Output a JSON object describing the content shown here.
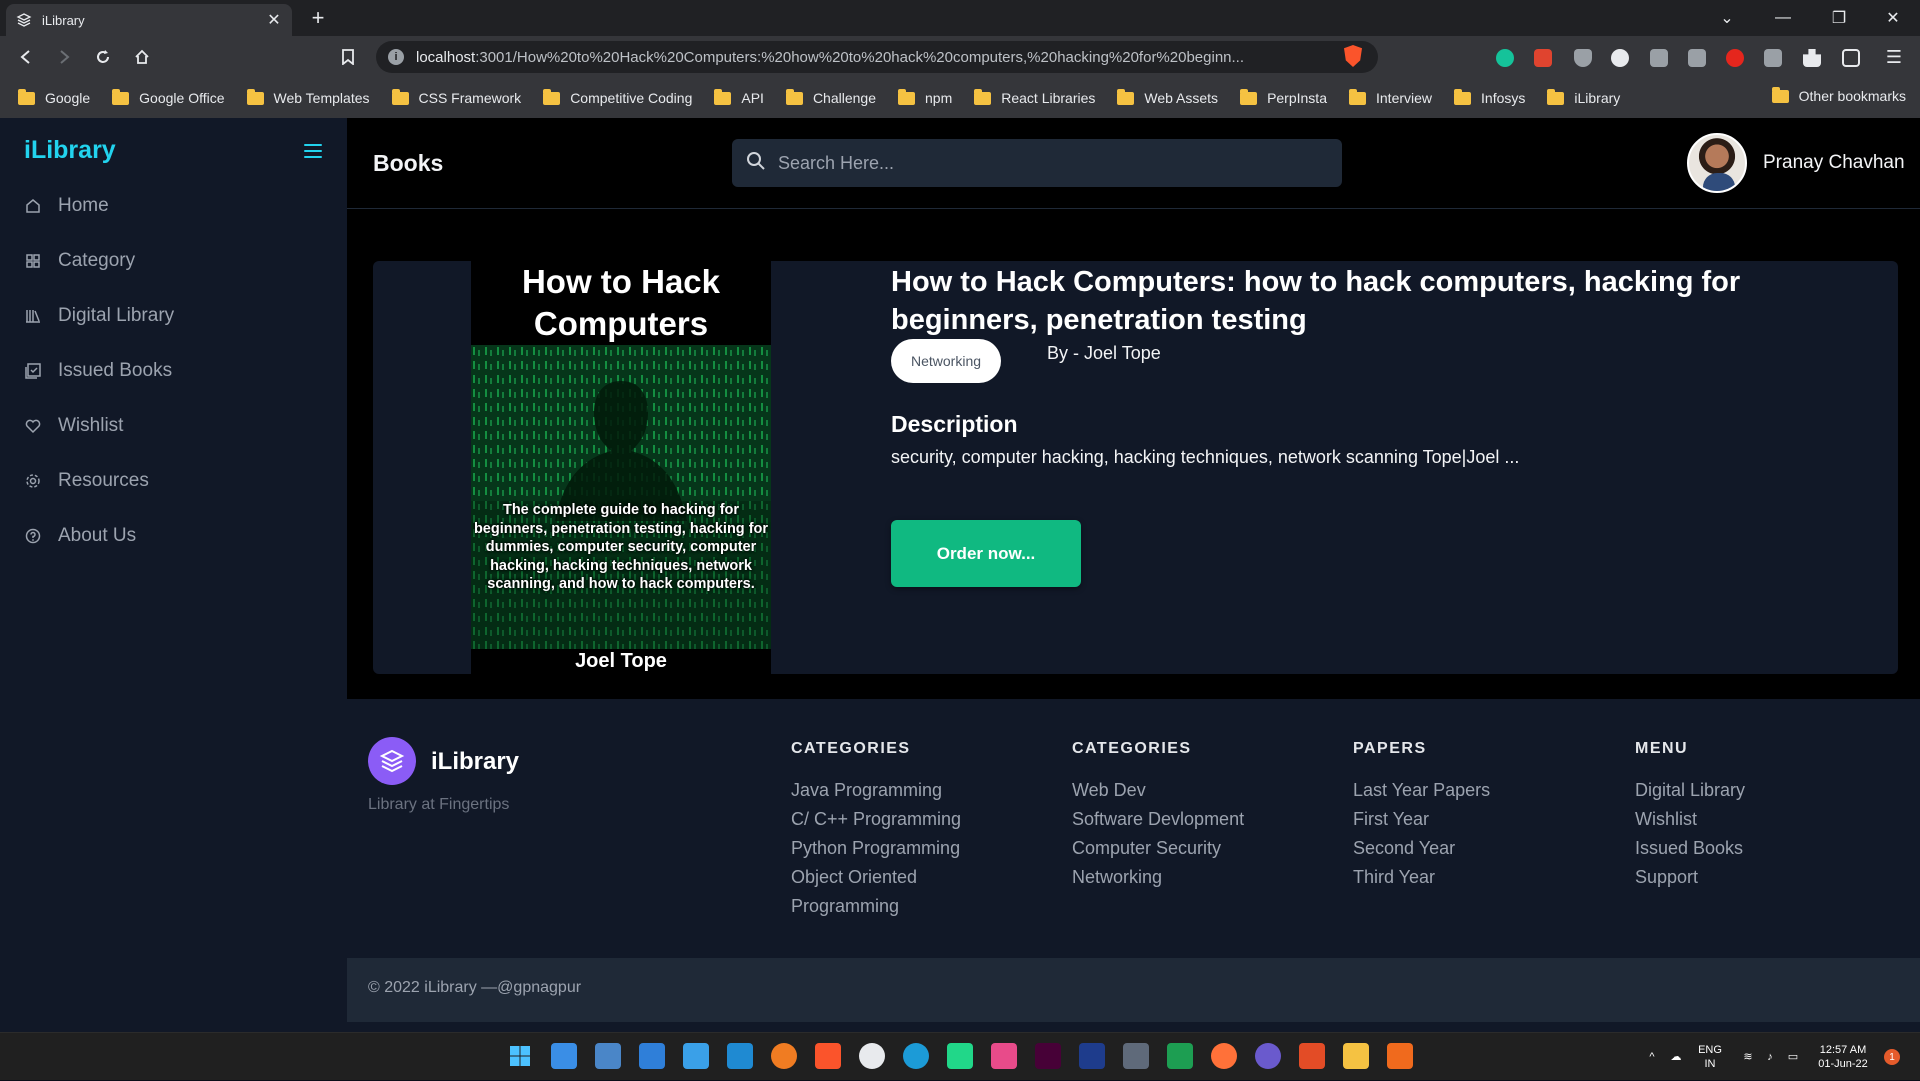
{
  "browser": {
    "tab_title": "iLibrary",
    "url_host": "localhost",
    "url_rest": ":3001/How%20to%20Hack%20Computers:%20how%20to%20hack%20computers,%20hacking%20for%20beginn...",
    "bookmarks": [
      "Google",
      "Google Office",
      "Web Templates",
      "CSS Framework",
      "Competitive Coding",
      "API",
      "Challenge",
      "npm",
      "React Libraries",
      "Web Assets",
      "PerpInsta",
      "Interview",
      "Infosys",
      "iLibrary"
    ],
    "other_bookmarks": "Other bookmarks"
  },
  "sidebar": {
    "logo": "iLibrary",
    "items": [
      {
        "label": "Home",
        "icon": "home-icon"
      },
      {
        "label": "Category",
        "icon": "grid-icon"
      },
      {
        "label": "Digital Library",
        "icon": "library-icon"
      },
      {
        "label": "Issued Books",
        "icon": "issued-books-icon"
      },
      {
        "label": "Wishlist",
        "icon": "heart-icon"
      },
      {
        "label": "Resources",
        "icon": "gear-icon"
      },
      {
        "label": "About Us",
        "icon": "help-circle-icon"
      }
    ]
  },
  "header": {
    "title": "Books",
    "search_placeholder": "Search Here...",
    "user_name": "Pranay Chavhan"
  },
  "book": {
    "cover_title": "How to Hack Computers",
    "cover_blurb": "The complete guide to hacking for beginners, penetration testing, hacking for dummies, computer security, computer hacking, hacking techniques, network scanning, and how to hack computers.",
    "cover_author": "Joel Tope",
    "title": "How to Hack Computers: how to hack computers, hacking for beginners, penetration testing",
    "category": "Networking",
    "author": "By - Joel Tope",
    "description_heading": "Description",
    "description": "security, computer hacking, hacking techniques, network scanning Tope|Joel ...",
    "order_label": "Order now..."
  },
  "footer": {
    "brand": "iLibrary",
    "tagline": "Library at Fingertips",
    "columns": [
      {
        "heading": "CATEGORIES",
        "links": [
          "Java Programming",
          "C/ C++ Programming",
          "Python Programming",
          "Object Oriented",
          "Programming"
        ]
      },
      {
        "heading": "CATEGORIES",
        "links": [
          "Web Dev",
          "Software Devlopment",
          "Computer Security",
          "Networking"
        ]
      },
      {
        "heading": "PAPERS",
        "links": [
          "Last Year Papers",
          "First Year",
          "Second Year",
          "Third Year"
        ]
      },
      {
        "heading": "MENU",
        "links": [
          "Digital Library",
          "Wishlist",
          "Issued Books",
          "Support"
        ]
      }
    ],
    "copyright": "© 2022 iLibrary —@gpnagpur"
  },
  "taskbar": {
    "lang_top": "ENG",
    "lang_bottom": "IN",
    "time": "12:57 AM",
    "date": "01-Jun-22",
    "notification_count": "1"
  },
  "colors": {
    "accent": "#22d3ee",
    "order_button": "#10b981",
    "sidebar_bg": "#111827",
    "main_bg": "#000000"
  }
}
